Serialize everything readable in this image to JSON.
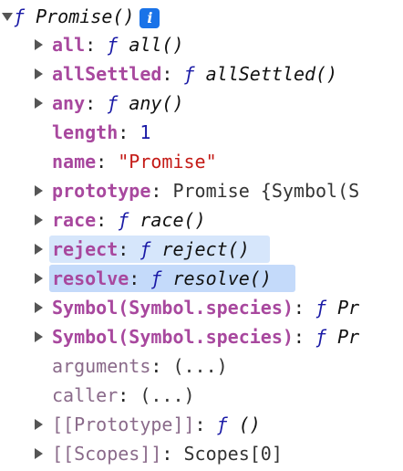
{
  "root": {
    "fn_symbol": "ƒ",
    "name": "Promise()",
    "info_badge": "i"
  },
  "properties": {
    "all": {
      "key": "all",
      "colon": ":",
      "fn_symbol": "ƒ",
      "value": "all()"
    },
    "allSettled": {
      "key": "allSettled",
      "colon": ":",
      "fn_symbol": "ƒ",
      "value": "allSettled()"
    },
    "any": {
      "key": "any",
      "colon": ":",
      "fn_symbol": "ƒ",
      "value": "any()"
    },
    "length": {
      "key": "length",
      "colon": ":",
      "value": "1"
    },
    "name": {
      "key": "name",
      "colon": ":",
      "value": "\"Promise\""
    },
    "prototype": {
      "key": "prototype",
      "colon": ":",
      "value": "Promise {Symbol(S"
    },
    "race": {
      "key": "race",
      "colon": ":",
      "fn_symbol": "ƒ",
      "value": "race()"
    },
    "reject": {
      "key": "reject",
      "colon": ":",
      "fn_symbol": "ƒ",
      "value": "reject()"
    },
    "resolve": {
      "key": "resolve",
      "colon": ":",
      "fn_symbol": "ƒ",
      "value": "resolve()"
    },
    "species_1": {
      "key": "Symbol(Symbol.species)",
      "colon": ":",
      "fn_symbol": "ƒ",
      "value": "Pr"
    },
    "species_2": {
      "key": "Symbol(Symbol.species)",
      "colon": ":",
      "fn_symbol": "ƒ",
      "value": "Pr"
    },
    "arguments": {
      "key": "arguments",
      "colon": ":",
      "value": "(...)"
    },
    "caller": {
      "key": "caller",
      "colon": ":",
      "value": "(...)"
    },
    "prototype_internal": {
      "key": "[[Prototype]]",
      "colon": ":",
      "fn_symbol": "ƒ",
      "value": "()"
    },
    "scopes_internal": {
      "key": "[[Scopes]]",
      "colon": ":",
      "value": "Scopes[0]"
    }
  },
  "colors": {
    "own_key": "#a8489e",
    "non_enumerable_key": "#8a6a8a",
    "function_symbol": "#1a1aa6",
    "number": "#1a1aa6",
    "string": "#c41a16",
    "selection": "#c4dafa",
    "hover": "#d6e6fb",
    "info_badge": "#1a73e8"
  },
  "highlighted_rows": [
    "reject",
    "resolve"
  ]
}
